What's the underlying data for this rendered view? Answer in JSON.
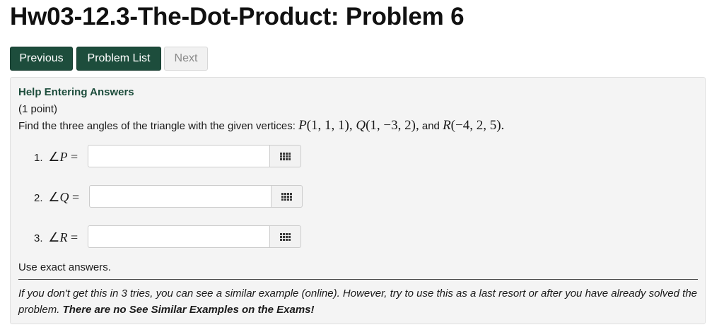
{
  "page": {
    "title": "Hw03-12.3-The-Dot-Product: Problem 6"
  },
  "nav": {
    "previous_label": "Previous",
    "problem_list_label": "Problem List",
    "next_label": "Next"
  },
  "problem": {
    "help_link": "Help Entering Answers",
    "points": "(1 point)",
    "question_text": "Find the three angles of the triangle with the given vertices:",
    "vertices": [
      {
        "name": "P",
        "coords": "(1, 1, 1)"
      },
      {
        "name": "Q",
        "coords": "(1, −3, 2)"
      },
      {
        "name": "R",
        "coords": "(−4, 2, 5)"
      }
    ],
    "conjunction": "and",
    "answers": [
      {
        "number": "1.",
        "angle": "∠",
        "var": "P",
        "equals": "=",
        "value": ""
      },
      {
        "number": "2.",
        "angle": "∠",
        "var": "Q",
        "equals": "=",
        "value": ""
      },
      {
        "number": "3.",
        "angle": "∠",
        "var": "R",
        "equals": "=",
        "value": ""
      }
    ],
    "instructions": "Use exact answers.",
    "hint_text": "If you don't get this in 3 tries, you can see a similar example (online). However, try to use this as a last resort or after you have already solved the problem.",
    "hint_bold": "There are no See Similar Examples on the Exams!"
  },
  "icons": {
    "palette": "grid-icon"
  },
  "colors": {
    "primary_button": "#1d4d3c",
    "help_link": "#1d4d3c",
    "problem_background": "#f4f4f4"
  }
}
